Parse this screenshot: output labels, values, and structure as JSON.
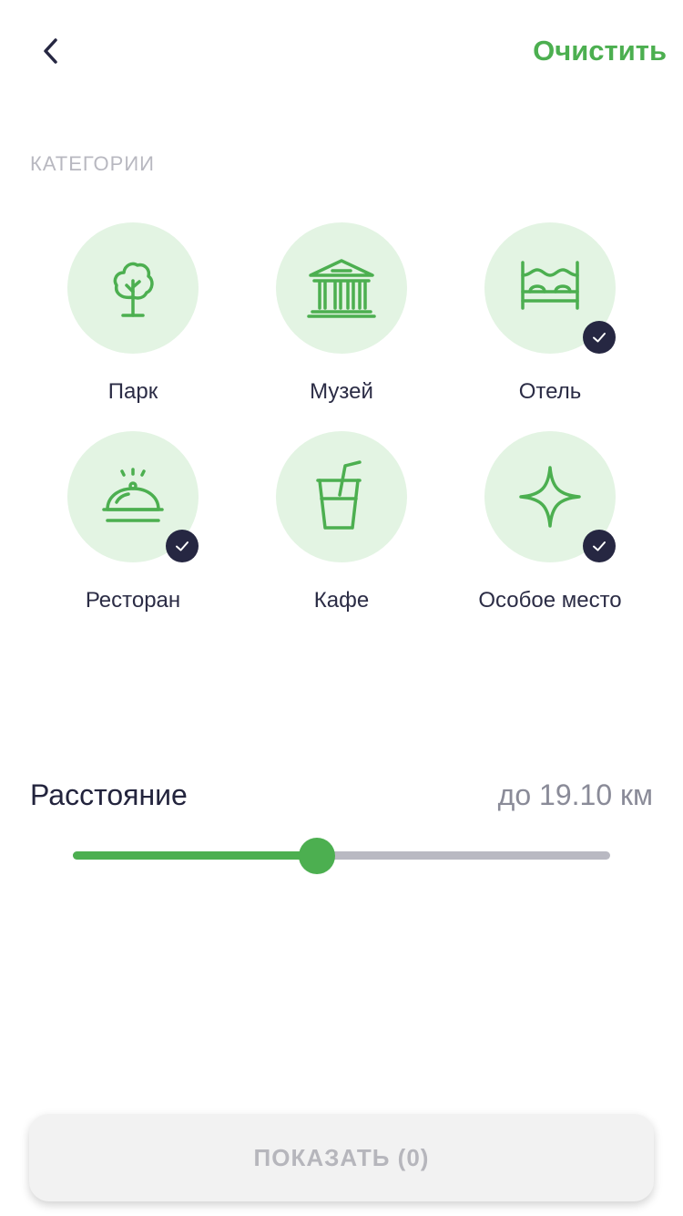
{
  "header": {
    "clear_label": "Очистить"
  },
  "categories_section": {
    "title": "КАТЕГОРИИ",
    "items": [
      {
        "label": "Парк",
        "icon": "tree-icon",
        "selected": false
      },
      {
        "label": "Музей",
        "icon": "museum-icon",
        "selected": false
      },
      {
        "label": "Отель",
        "icon": "bed-icon",
        "selected": true
      },
      {
        "label": "Ресторан",
        "icon": "cloche-icon",
        "selected": true
      },
      {
        "label": "Кафе",
        "icon": "drink-icon",
        "selected": false
      },
      {
        "label": "Особое место",
        "icon": "sparkle-icon",
        "selected": true
      }
    ]
  },
  "distance": {
    "title": "Расстояние",
    "value_text": "до 19.10 км",
    "slider_fraction": 0.455
  },
  "footer": {
    "show_label": "ПОКАЗАТЬ (0)"
  },
  "colors": {
    "accent": "#4caf50",
    "icon_circle_bg": "#e3f4e3",
    "check_badge": "#262742",
    "text_dark": "#23243d",
    "text_muted": "#8a8b98"
  }
}
